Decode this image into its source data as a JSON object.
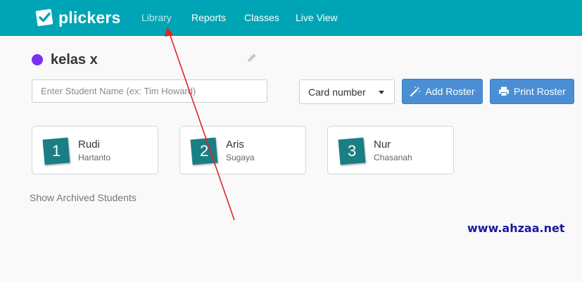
{
  "app": {
    "name": "plickers",
    "logo_icon": "plickers-logo-icon"
  },
  "nav": {
    "items": [
      {
        "label": "Library",
        "active": true
      },
      {
        "label": "Reports",
        "active": false
      },
      {
        "label": "Classes",
        "active": false
      },
      {
        "label": "Live View",
        "active": false
      }
    ]
  },
  "class": {
    "name": "kelas x",
    "color": "#7b2ff7"
  },
  "search": {
    "placeholder": "Enter Student Name (ex: Tim Howard)",
    "value": ""
  },
  "sort_select": {
    "selected": "Card number"
  },
  "buttons": {
    "add_roster": "Add Roster",
    "print_roster": "Print Roster"
  },
  "students": [
    {
      "number": "1",
      "first_name": "Rudi",
      "last_name": "Hartanto"
    },
    {
      "number": "2",
      "first_name": "Aris",
      "last_name": "Sugaya"
    },
    {
      "number": "3",
      "first_name": "Nur",
      "last_name": "Chasanah"
    }
  ],
  "show_archived": "Show Archived Students",
  "watermark": "www.ahzaa.net",
  "colors": {
    "topbar": "#00a5b5",
    "button": "#4a8fd4",
    "badge": "#1a7e84",
    "annotation_arrow": "#e02424"
  }
}
